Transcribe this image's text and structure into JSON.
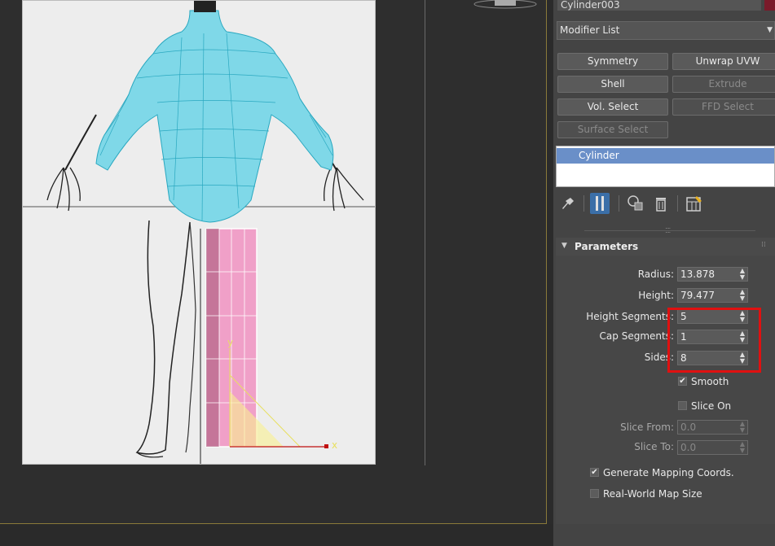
{
  "object_name": "Cylinder003",
  "modifier_list_label": "Modifier List",
  "modifier_buttons": [
    {
      "label": "Symmetry",
      "enabled": true
    },
    {
      "label": "Unwrap UVW",
      "enabled": true
    },
    {
      "label": "Shell",
      "enabled": true
    },
    {
      "label": "Extrude",
      "enabled": false
    },
    {
      "label": "Vol. Select",
      "enabled": true
    },
    {
      "label": "FFD Select",
      "enabled": false
    },
    {
      "label": "Surface Select",
      "enabled": false
    }
  ],
  "stack_items": [
    "Cylinder"
  ],
  "stack_toolbar_icons": [
    "pin-stack-icon",
    "show-end-result-icon",
    "make-unique-icon",
    "remove-modifier-icon",
    "configure-modifier-sets-icon"
  ],
  "parameters": {
    "title": "Parameters",
    "radius_label": "Radius:",
    "radius_value": "13.878",
    "height_label": "Height:",
    "height_value": "79.477",
    "height_segments_label": "Height Segments:",
    "height_segments_value": "5",
    "cap_segments_label": "Cap Segments:",
    "cap_segments_value": "1",
    "sides_label": "Sides:",
    "sides_value": "8",
    "smooth_label": "Smooth",
    "smooth_checked": true,
    "slice_on_label": "Slice On",
    "slice_on_checked": false,
    "slice_from_label": "Slice From:",
    "slice_from_value": "0.0",
    "slice_to_label": "Slice To:",
    "slice_to_value": "0.0",
    "gen_mapping_label": "Generate Mapping Coords.",
    "gen_mapping_checked": true,
    "real_world_label": "Real-World Map Size",
    "real_world_checked": false
  },
  "gizmo": {
    "y_label": "y",
    "x_label": "x"
  },
  "colors": {
    "highlight": "#e01010",
    "selection": "#6a8fc8",
    "torso": "#7fd8e8",
    "cylinder": "#f0a0c8"
  }
}
